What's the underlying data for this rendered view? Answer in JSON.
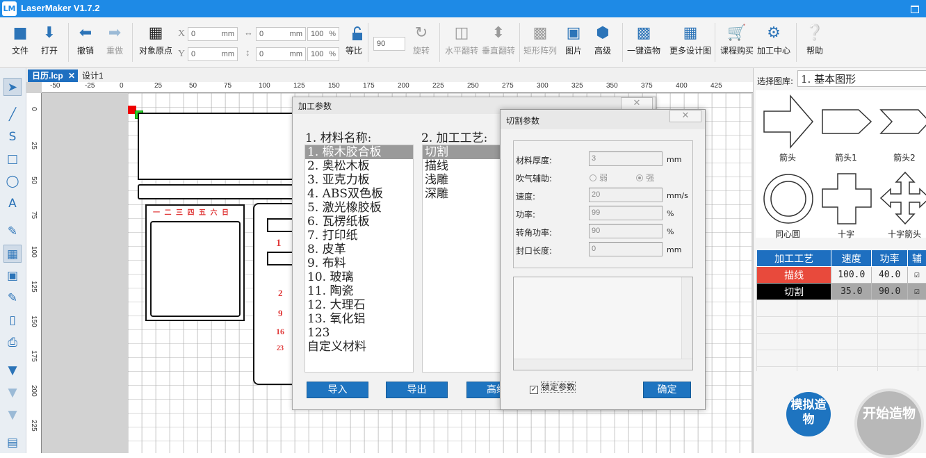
{
  "app": {
    "title": "LaserMaker V1.7.2",
    "logo_text": "LM"
  },
  "toolbar": {
    "file": "文件",
    "open": "打开",
    "undo": "撤销",
    "redo": "重做",
    "object_origin": "对象原点",
    "x_label": "X",
    "y_label": "Y",
    "x_value": "0",
    "y_value": "0",
    "w_value": "0",
    "h_value": "0",
    "w_pct": "100",
    "h_pct": "100",
    "unit_mm": "mm",
    "unit_pct": "%",
    "ratio": "等比",
    "rotate_value": "90",
    "rotate": "旋转",
    "flip_h": "水平翻转",
    "flip_v": "垂直翻转",
    "array": "矩形阵列",
    "image": "图片",
    "advanced": "高级",
    "one_click": "一键造物",
    "more_designs": "更多设计图",
    "courses": "课程购买",
    "process_center": "加工中心",
    "help": "帮助"
  },
  "tabs": {
    "active": "日历.lcp",
    "active_close": "✕",
    "second": "设计1"
  },
  "ruler": {
    "h_labels": [
      "-50",
      "-25",
      "0",
      "25",
      "50",
      "75",
      "100",
      "125",
      "150",
      "175",
      "200",
      "225",
      "250",
      "275",
      "300",
      "325",
      "350",
      "375",
      "400",
      "425"
    ],
    "v_labels": [
      "0",
      "25",
      "50",
      "75",
      "100",
      "125",
      "150",
      "175",
      "200",
      "225"
    ],
    "unit": "mm"
  },
  "canvas": {
    "red_numbers": [
      "1",
      "2",
      "9",
      "16",
      "23"
    ],
    "top_text": "一 二 三 四 五 六 日"
  },
  "library": {
    "label": "选择图库:",
    "selected": "1. 基本图形",
    "items": [
      "箭头",
      "箭头1",
      "箭头2",
      "同心圆",
      "十字",
      "十字箭头"
    ]
  },
  "process_table": {
    "headers": [
      "加工工艺",
      "速度",
      "功率",
      "辅"
    ],
    "rows": [
      {
        "name": "描线",
        "speed": "100.0",
        "power": "40.0",
        "color": "#e84a3c"
      },
      {
        "name": "切割",
        "speed": "35.0",
        "power": "90.0",
        "color": "#000000"
      }
    ]
  },
  "buttons": {
    "simulate": "模拟造物",
    "start": "开始造物"
  },
  "dialog_main": {
    "title": "加工参数",
    "close": "✕",
    "material_head": "1. 材料名称:",
    "process_head": "2. 加工工艺:",
    "materials": [
      "1. 椴木胶合板",
      "2. 奥松木板",
      "3. 亚克力板",
      "4. ABS双色板",
      "5. 激光橡胶板",
      "6. 瓦楞纸板",
      "7. 打印纸",
      "8. 皮革",
      "9. 布料",
      "10. 玻璃",
      "11. 陶瓷",
      "12. 大理石",
      "13. 氧化铝",
      "123",
      "自定义材料"
    ],
    "processes": [
      "切割",
      "描线",
      "浅雕",
      "深雕"
    ],
    "import": "导入",
    "export": "导出",
    "advanced": "高级"
  },
  "dialog_cut": {
    "title": "切割参数",
    "close": "✕",
    "thickness_label": "材料厚度:",
    "thickness": "3",
    "thickness_unit": "mm",
    "air_label": "吹气辅助:",
    "air_weak": "弱",
    "air_strong": "强",
    "speed_label": "速度:",
    "speed": "20",
    "speed_unit": "mm/s",
    "power_label": "功率:",
    "power": "99",
    "power_unit": "%",
    "corner_label": "转角功率:",
    "corner": "90",
    "corner_unit": "%",
    "seal_label": "封口长度:",
    "seal": "0",
    "seal_unit": "mm",
    "lock_label": "锁定参数",
    "confirm": "确定"
  }
}
